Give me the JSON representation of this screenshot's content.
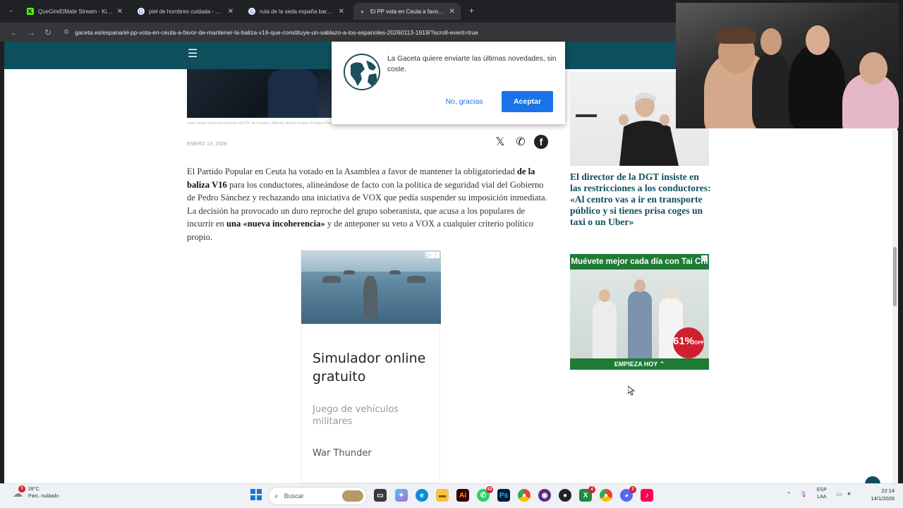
{
  "browser": {
    "tabs": [
      {
        "title": "QueGireElMate Stream - Kick D...",
        "favicon": "K",
        "favicon_color": "#53fc18",
        "active": false
      },
      {
        "title": "piel de hombres cuidada - Busc...",
        "favicon": "G",
        "favicon_color": "#ffffff",
        "active": false
      },
      {
        "title": "ruta de la seda españa barrio p...",
        "favicon": "G",
        "favicon_color": "#ffffff",
        "active": false
      },
      {
        "title": "El PP vota en Ceuta a favor de ...",
        "favicon": "◐",
        "favicon_color": "#e8eaed",
        "active": true
      }
    ],
    "new_tab": "+",
    "url": "gaceta.es/espana/el-pp-vota-en-ceuta-a-favor-de-mantener-la-baliza-v16-que-constituye-un-sablazo-a-los-espanoles-20260113-1919/?scroll-event=true"
  },
  "article": {
    "caption": "Juan Jesús Vivas (presidente del PP de Ceuta) y Alberto Núñez Feijóo. Europa Press",
    "date": "ENERO 13, 2026",
    "share": {
      "x": "𝕏",
      "whatsapp": "✆",
      "facebook": "f"
    },
    "paragraph": [
      {
        "text": "El Partido Popular en Ceuta ha votado en la Asamblea a favor de mantener la obligatoriedad ",
        "bold": false
      },
      {
        "text": "de la baliza V16",
        "bold": true
      },
      {
        "text": " para los conductores, alineándose de facto con la política de seguridad vial del Gobierno de Pedro Sánchez y rechazando una iniciativa de VOX que pedía suspender su imposición inmediata. La decisión ha provocado un duro reproche del grupo soberanista, que acusa a los populares de incurrir en ",
        "bold": false
      },
      {
        "text": "una «nueva incoherencia»",
        "bold": true
      },
      {
        "text": " y de anteponer su veto a VOX a cualquier criterio político propio.",
        "bold": false
      }
    ]
  },
  "ad_inline": {
    "headline": "Simulador online gratuito",
    "subtitle": "Juego de vehículos militares",
    "brand": "War Thunder",
    "adchoice": "▷ ⋮"
  },
  "sidebar": {
    "headline": "El director de la DGT insiste en las restricciones a los conductores: «Al centro vas a ir en transporte público y si tienes prisa coges un taxi o un Uber»"
  },
  "ad_side": {
    "title": "Muévete mejor cada día con Tai Chi",
    "badge_value": "61%",
    "badge_suffix": "OFF",
    "cta": "EMPIEZA HOY ⌃"
  },
  "popup": {
    "message": "La Gaceta quiere enviarte las últimas novedades, sin coste.",
    "decline": "No, gracias",
    "accept": "Aceptar"
  },
  "taskbar": {
    "weather_temp": "28°C",
    "weather_desc": "Parc. nublado",
    "weather_badge": "5",
    "search_placeholder": "Buscar",
    "badges": {
      "whatsapp": "43",
      "discord": "2",
      "other": "4"
    },
    "lang": "ESP",
    "lang2": "LAA",
    "time": "22:14",
    "date": "14/1/2026"
  },
  "colors": {
    "site_bar": "#0e4f5e",
    "headline": "#0e4f5e",
    "accept_button": "#1a73e8",
    "ad_green": "#1f7a34",
    "badge_red": "#d0202e"
  }
}
